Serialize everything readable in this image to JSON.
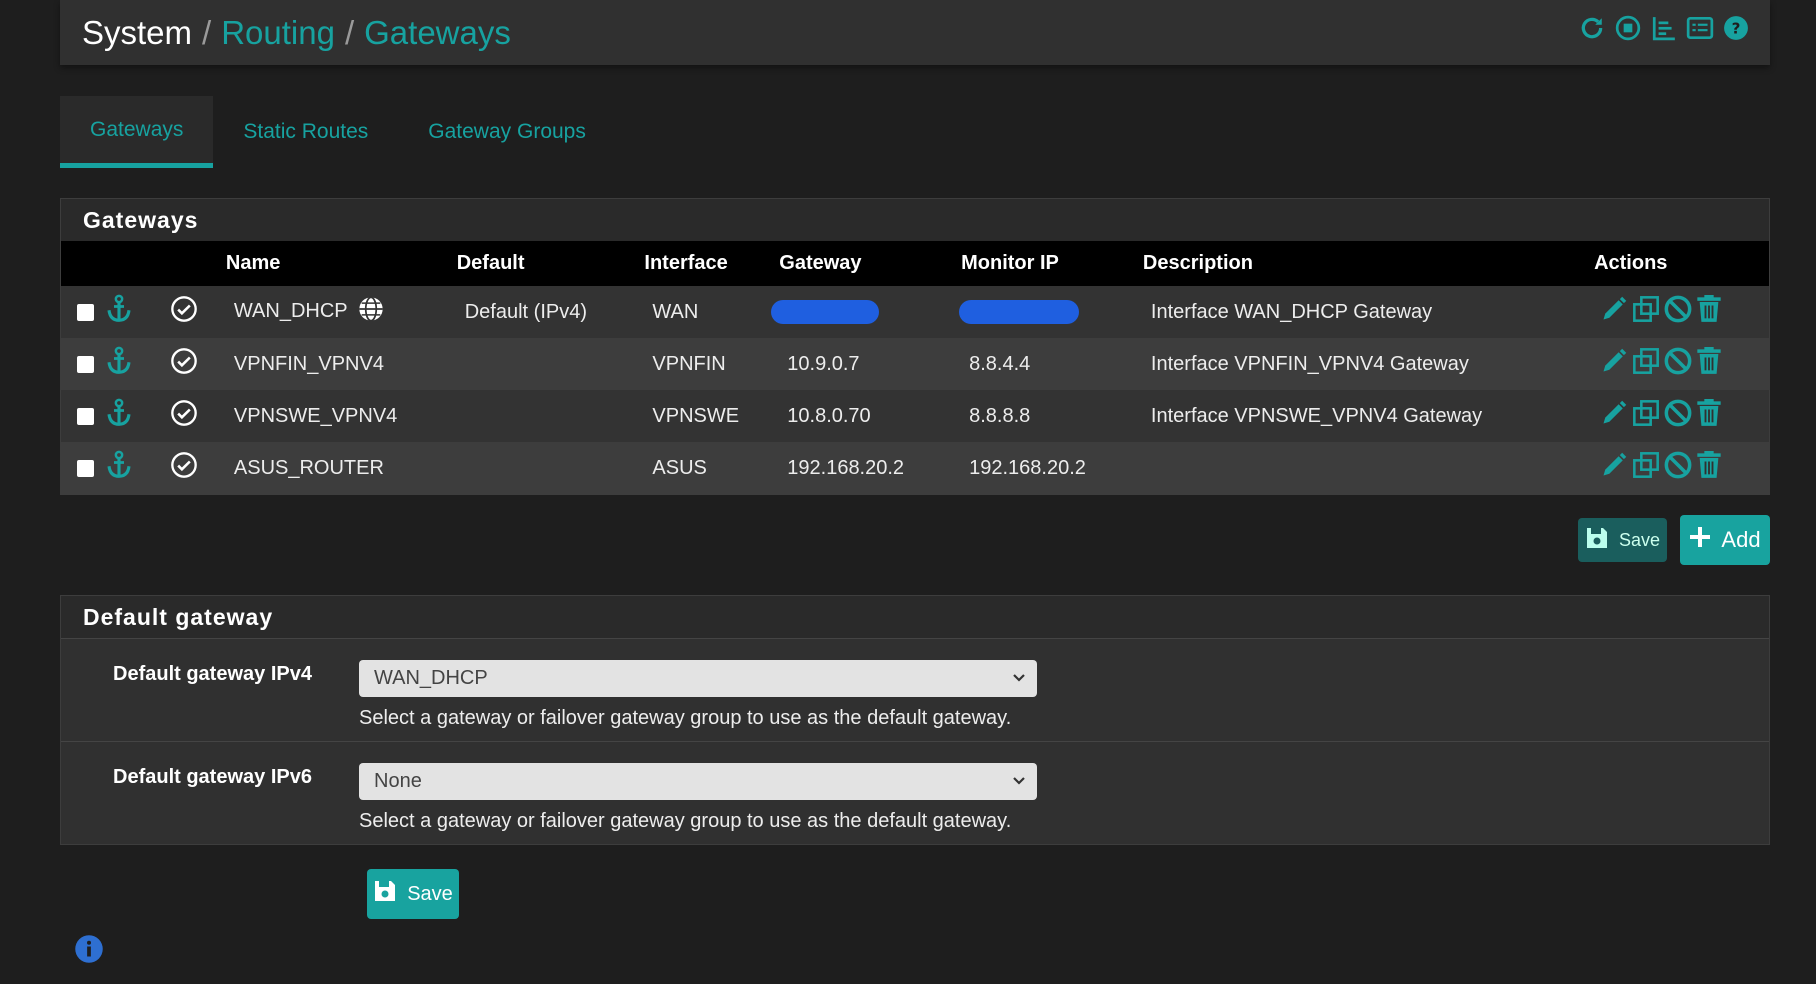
{
  "breadcrumb": {
    "system": "System",
    "sep": "/",
    "routing": "Routing",
    "gateways": "Gateways"
  },
  "header_icons": [
    "reload-icon",
    "stop-circle-icon",
    "chart-icon",
    "list-icon",
    "help-icon"
  ],
  "tabs": [
    {
      "label": "Gateways",
      "active": true
    },
    {
      "label": "Static Routes",
      "active": false
    },
    {
      "label": "Gateway Groups",
      "active": false
    }
  ],
  "gateways_panel": {
    "title": "Gateways",
    "columns": {
      "name": "Name",
      "default": "Default",
      "interface": "Interface",
      "gateway": "Gateway",
      "monitor": "Monitor IP",
      "description": "Description",
      "actions": "Actions"
    },
    "rows": [
      {
        "name": "WAN_DHCP",
        "default": "Default (IPv4)",
        "interface": "WAN",
        "gateway": "",
        "monitor": "",
        "description": "Interface WAN_DHCP Gateway"
      },
      {
        "name": "VPNFIN_VPNV4",
        "default": "",
        "interface": "VPNFIN",
        "gateway": "10.9.0.7",
        "monitor": "8.8.4.4",
        "description": "Interface VPNFIN_VPNV4 Gateway"
      },
      {
        "name": "VPNSWE_VPNV4",
        "default": "",
        "interface": "VPNSWE",
        "gateway": "10.8.0.70",
        "monitor": "8.8.8.8",
        "description": "Interface VPNSWE_VPNV4 Gateway"
      },
      {
        "name": "ASUS_ROUTER",
        "default": "",
        "interface": "ASUS",
        "gateway": "192.168.20.2",
        "monitor": "192.168.20.2",
        "description": ""
      }
    ],
    "save_label": "Save",
    "add_label": "Add"
  },
  "default_gateway": {
    "title": "Default gateway",
    "ipv4": {
      "label": "Default gateway IPv4",
      "value": "WAN_DHCP",
      "help": "Select a gateway or failover gateway group to use as the default gateway."
    },
    "ipv6": {
      "label": "Default gateway IPv6",
      "value": "None",
      "help": "Select a gateway or failover gateway group to use as the default gateway."
    },
    "save_label": "Save"
  },
  "colors": {
    "accent": "#17a2a0",
    "button": "#117a78",
    "redaction": "#1f5fe0"
  }
}
